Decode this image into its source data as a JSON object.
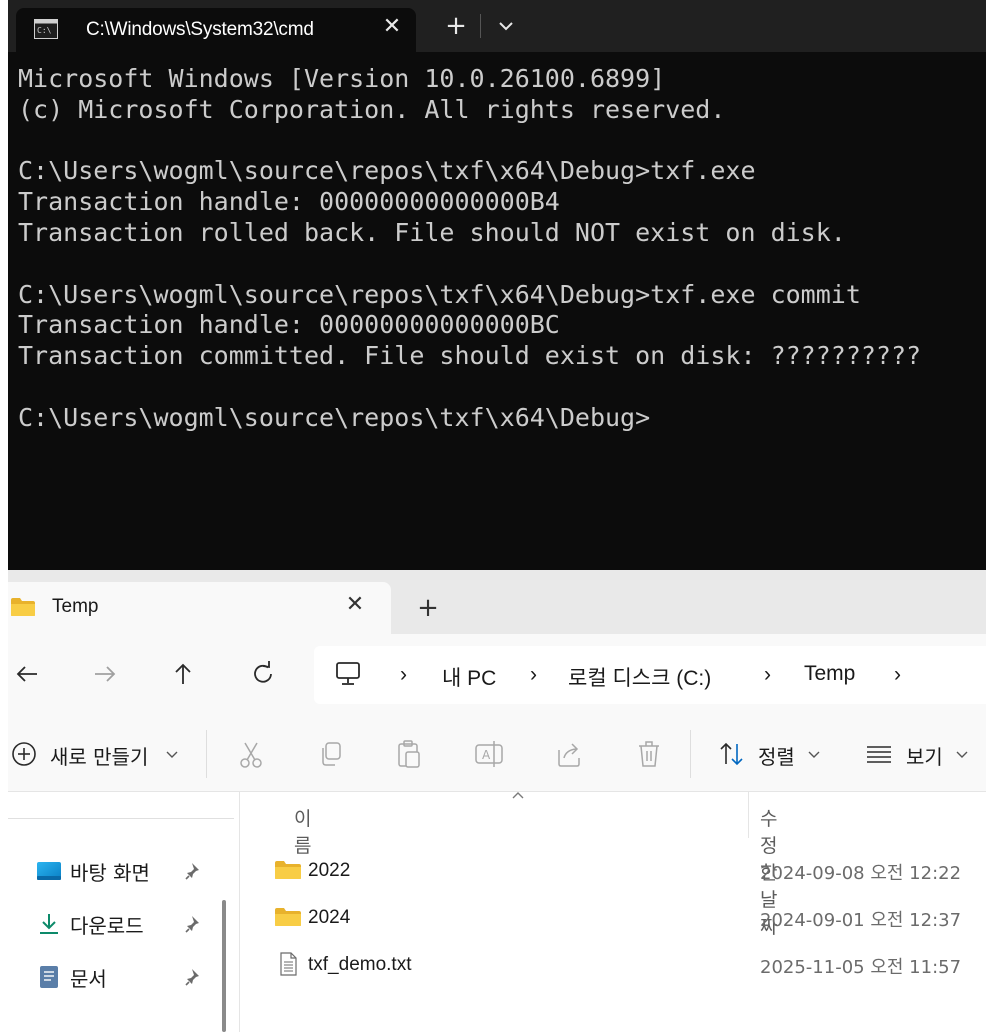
{
  "terminal": {
    "tab_title": "C:\\Windows\\System32\\cmd",
    "lines": [
      "Microsoft Windows [Version 10.0.26100.6899]",
      "(c) Microsoft Corporation. All rights reserved.",
      "",
      "C:\\Users\\wogml\\source\\repos\\txf\\x64\\Debug>txf.exe",
      "Transaction handle: 00000000000000B4",
      "Transaction rolled back. File should NOT exist on disk.",
      "",
      "C:\\Users\\wogml\\source\\repos\\txf\\x64\\Debug>txf.exe commit",
      "Transaction handle: 00000000000000BC",
      "Transaction committed. File should exist on disk: ??????????",
      "",
      "C:\\Users\\wogml\\source\\repos\\txf\\x64\\Debug>"
    ],
    "icons": {
      "tab": "console-icon",
      "close": "close-icon",
      "new_tab": "plus-icon",
      "dropdown": "chevron-down-icon"
    }
  },
  "explorer": {
    "tab_title": "Temp",
    "breadcrumb": [
      "내 PC",
      "로컬 디스크 (C:)",
      "Temp"
    ],
    "toolbar": {
      "new_label": "새로 만들기",
      "sort_label": "정렬",
      "view_label": "보기"
    },
    "columns": {
      "name": "이름",
      "modified": "수정한 날짜"
    },
    "sidebar": [
      {
        "label": "바탕 화면",
        "icon": "desktop-icon"
      },
      {
        "label": "다운로드",
        "icon": "download-icon"
      },
      {
        "label": "문서",
        "icon": "document-icon"
      }
    ],
    "files": [
      {
        "name": "2022",
        "modified": "2024-09-08 오전 12:22",
        "icon": "folder-icon"
      },
      {
        "name": "2024",
        "modified": "2024-09-01 오전 12:37",
        "icon": "folder-icon"
      },
      {
        "name": "txf_demo.txt",
        "modified": "2025-11-05 오전 11:57",
        "icon": "text-file-icon"
      }
    ],
    "colors": {
      "folder": "#f4c430",
      "accent": "#0067c0",
      "terminal_bg": "#0c0c0c",
      "terminal_text": "#cccccc"
    }
  }
}
